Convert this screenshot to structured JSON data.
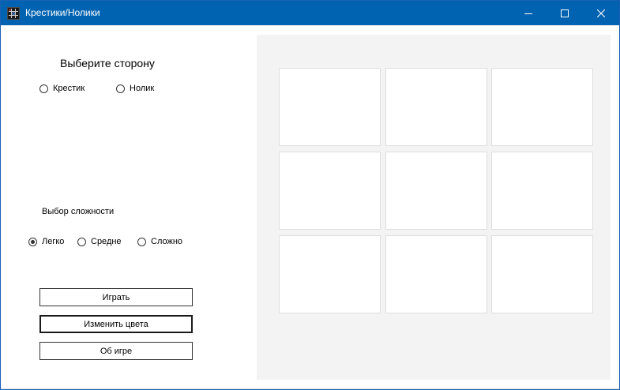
{
  "window": {
    "title": "Крестики/Нолики",
    "accent_color": "#0063b1",
    "icon": "app-grid-icon"
  },
  "controls": {
    "minimize_icon": "minimize-icon",
    "maximize_icon": "maximize-icon",
    "close_icon": "close-icon"
  },
  "side": {
    "title": "Выберите сторону",
    "options": [
      {
        "label": "Крестик",
        "checked": false
      },
      {
        "label": "Нолик",
        "checked": false
      }
    ]
  },
  "difficulty": {
    "title": "Выбор сложности",
    "options": [
      {
        "label": "Легко",
        "checked": true
      },
      {
        "label": "Средне",
        "checked": false
      },
      {
        "label": "Сложно",
        "checked": false
      }
    ]
  },
  "buttons": {
    "play": "Играть",
    "change_colors": "Изменить цвета",
    "about": "Об игре"
  },
  "board": {
    "rows": 3,
    "cols": 3,
    "cells": [
      "",
      "",
      "",
      "",
      "",
      "",
      "",
      "",
      ""
    ],
    "panel_color": "#f3f3f3"
  }
}
